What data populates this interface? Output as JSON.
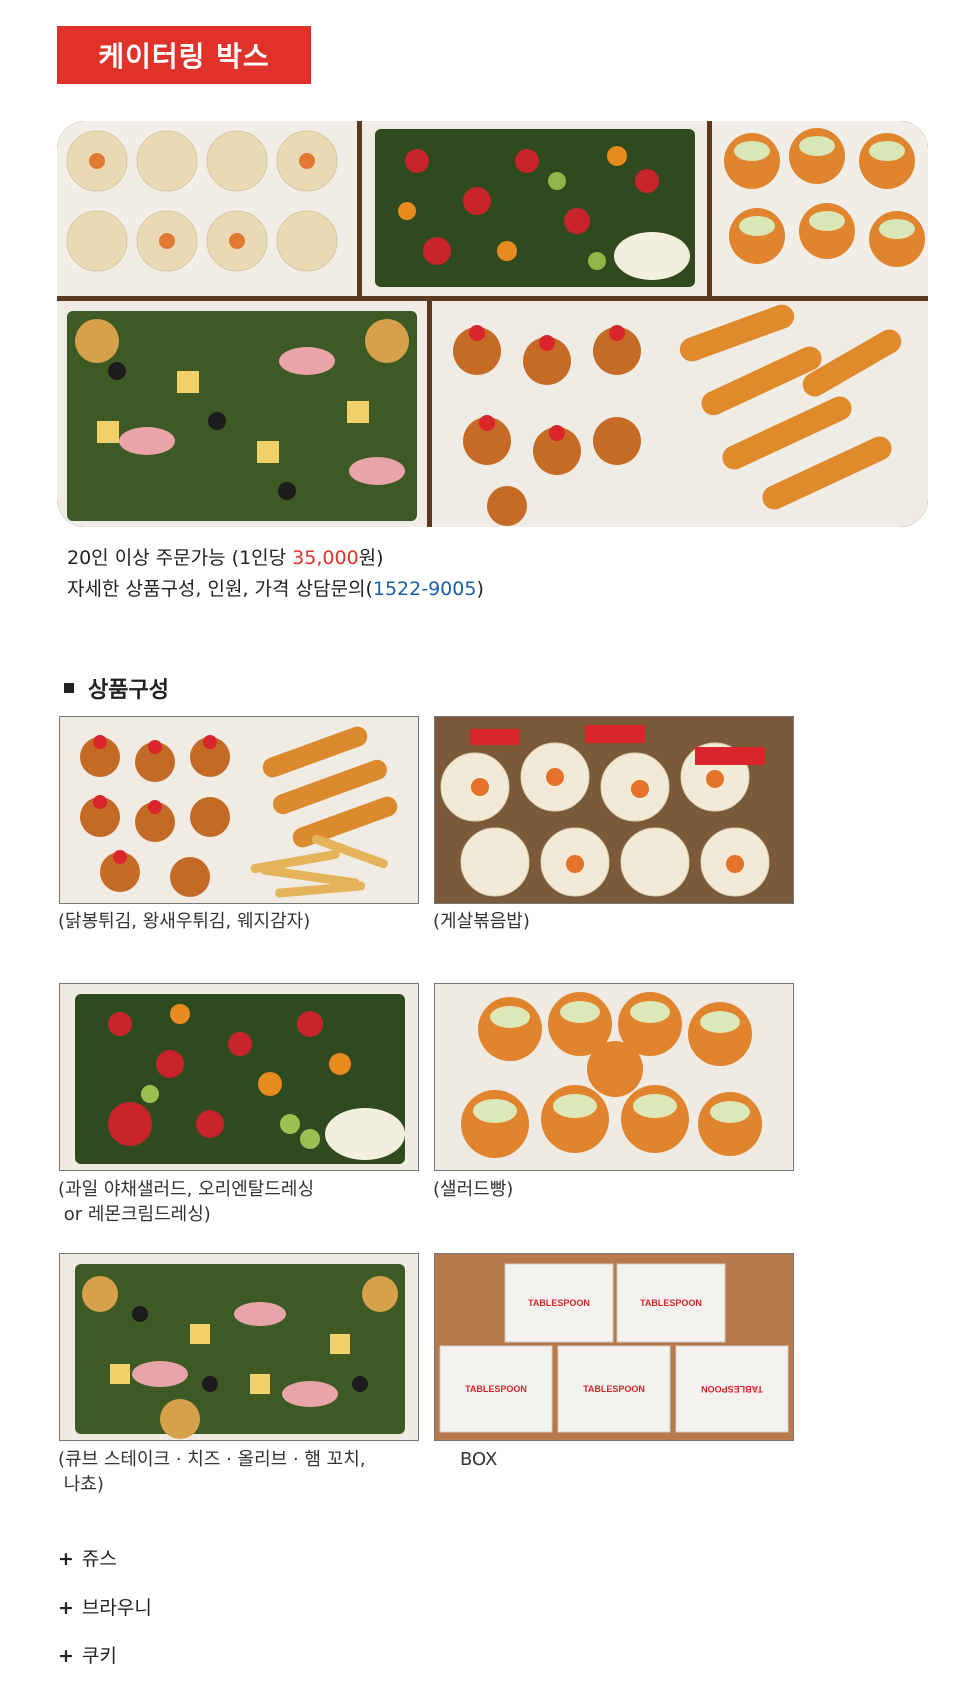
{
  "header": {
    "title": "케이터링 박스"
  },
  "info": {
    "line1_prefix": "20인 이상 주문가능 (1인당 ",
    "line1_price": "35,000",
    "line1_suffix": "원)",
    "line2_prefix": "자세한 상품구성, 인원, 가격 상담문의(",
    "line2_phone": "1522-9005",
    "line2_suffix": ")"
  },
  "section": {
    "title": "상품구성"
  },
  "products": [
    {
      "caption": "(닭봉튀김, 왕새우튀김, 웨지감자)"
    },
    {
      "caption": "(게살볶음밥)"
    },
    {
      "caption": "(과일 야채샐러드, 오리엔탈드레싱\n or 레몬크림드레싱)"
    },
    {
      "caption": "(샐러드빵)"
    },
    {
      "caption": "(큐브 스테이크 · 치즈 · 올리브 · 햄 꼬치,\n 나쵸)"
    },
    {
      "caption": "BOX"
    }
  ],
  "box_brand": "TABLESPOON",
  "extras": [
    {
      "plus": "+",
      "label": "쥬스"
    },
    {
      "plus": "+",
      "label": "브라우니"
    },
    {
      "plus": "+",
      "label": "쿠키"
    }
  ],
  "colors": {
    "accent": "#e0312b",
    "phone": "#1a5ea8"
  }
}
